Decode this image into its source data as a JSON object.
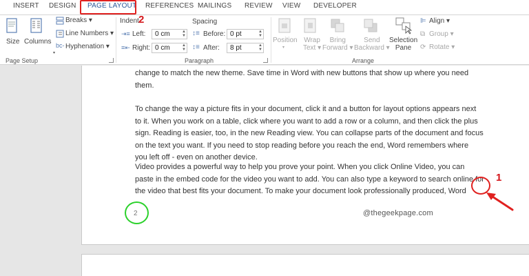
{
  "tabs": [
    {
      "label": "INSERT"
    },
    {
      "label": "DESIGN"
    },
    {
      "label": "PAGE LAYOUT"
    },
    {
      "label": "REFERENCES"
    },
    {
      "label": "MAILINGS"
    },
    {
      "label": "REVIEW"
    },
    {
      "label": "VIEW"
    },
    {
      "label": "DEVELOPER"
    }
  ],
  "active_tab": "PAGE LAYOUT",
  "annotations": {
    "step1": "1",
    "step2": "2"
  },
  "ribbon": {
    "page_setup": {
      "size": "Size",
      "columns": "Columns",
      "breaks": "Breaks",
      "line_numbers": "Line Numbers",
      "hyphenation": "Hyphenation",
      "group_label": "Page Setup"
    },
    "paragraph": {
      "indent_label": "Indent",
      "spacing_label": "Spacing",
      "left_label": "Left:",
      "right_label": "Right:",
      "before_label": "Before:",
      "after_label": "After:",
      "left_value": "0 cm",
      "right_value": "0 cm",
      "before_value": "0 pt",
      "after_value": "8 pt",
      "group_label": "Paragraph"
    },
    "arrange": {
      "position": "Position",
      "wrap_text_1": "Wrap",
      "wrap_text_2": "Text",
      "bring_forward_1": "Bring",
      "bring_forward_2": "Forward",
      "send_backward_1": "Send",
      "send_backward_2": "Backward",
      "selection_pane_1": "Selection",
      "selection_pane_2": "Pane",
      "align": "Align",
      "group": "Group",
      "rotate": "Rotate",
      "group_label": "Arrange"
    }
  },
  "document": {
    "para0_line1": "change to match the new theme. Save time in Word with new buttons that show up where you need",
    "para0_line2": "them.",
    "para1_line1": "To change the way a picture fits in your document, click it and a button for layout options appears next",
    "para1_line2": "to it. When you work on a table, click where you want to add a row or a column, and then click the plus",
    "para1_line3": "sign. Reading is easier, too, in the new Reading view. You can collapse parts of the document and focus",
    "para1_line4": "on the text you want. If you need to stop reading before you reach the end, Word remembers where",
    "para1_line5": "you left off - even on another device.",
    "para2_line1": "Video provides a powerful way to help you prove your point. When you click Online Video, you can",
    "para2_line2": "paste in the embed code for the video you want to add. You can also type a keyword to search online for",
    "para2_line3": "the video that best fits your document. To make your document look professionally produced, Word",
    "page_number": "2",
    "watermark": "@thegeekpage.com"
  }
}
